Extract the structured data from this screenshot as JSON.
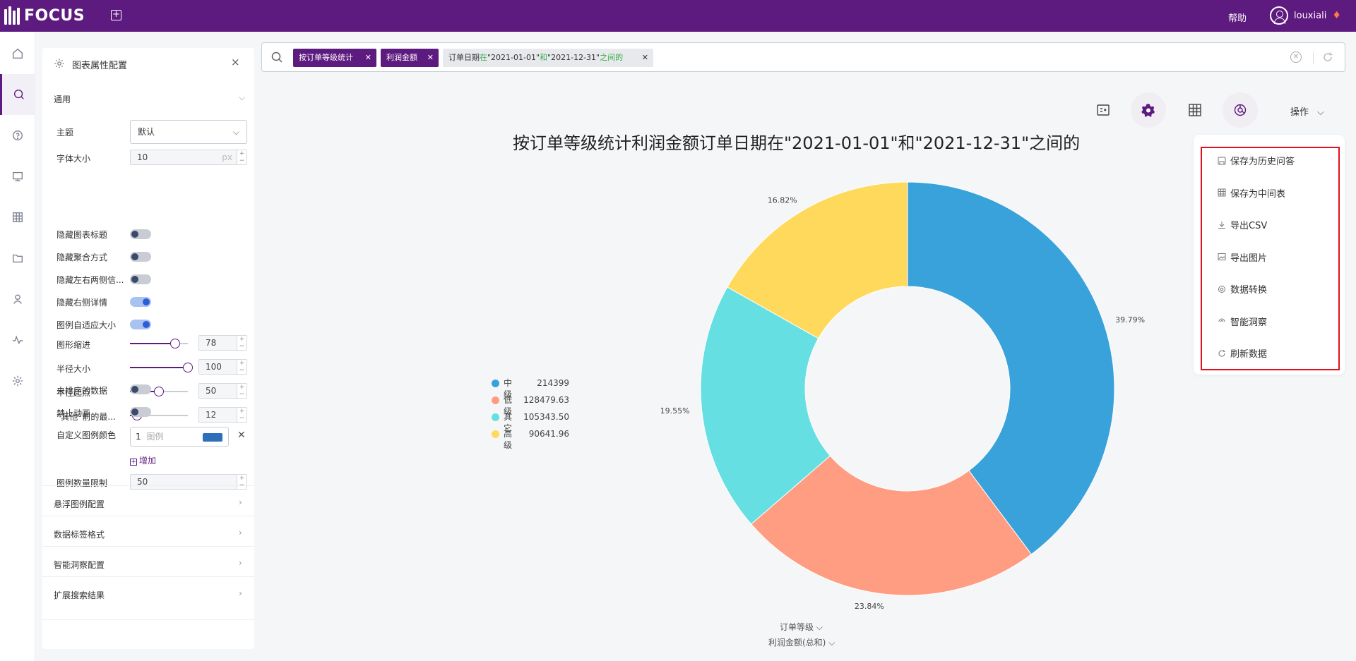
{
  "app": {
    "logo_text": "FOCUS",
    "help_label": "帮助",
    "username": "louxiali"
  },
  "panel": {
    "title": "图表属性配置",
    "general_section": "通用",
    "theme_label": "主题",
    "theme_value": "默认",
    "font_size_label": "字体大小",
    "font_size_value": "10",
    "font_size_unit": "px",
    "toggles": [
      {
        "label": "隐藏图表标题",
        "on": false
      },
      {
        "label": "隐藏聚合方式",
        "on": false
      },
      {
        "label": "隐藏左右两侧信...",
        "on": false
      },
      {
        "label": "隐藏右侧详情",
        "on": true
      },
      {
        "label": "图例自适应大小",
        "on": true
      }
    ],
    "sliders": [
      {
        "label": "图形缩进",
        "value": "78",
        "fraction": 0.78
      },
      {
        "label": "半径大小",
        "value": "100",
        "fraction": 1.0
      },
      {
        "label": "半径起点",
        "value": "50",
        "fraction": 0.5
      },
      {
        "label": "“其他”前的最...",
        "value": "12",
        "fraction": 0.12
      }
    ],
    "unsorted_label": "未排序的数据",
    "disable_anim_label": "禁止动画",
    "custom_color_label": "自定义图例颜色",
    "color_index": "1",
    "color_placeholder": "图例",
    "color_swatch": "#2d6fb8",
    "add_label": "增加",
    "legend_limit_label": "图例数量限制",
    "legend_limit_value": "50",
    "sections": [
      "悬浮图例配置",
      "数据标签格式",
      "智能洞察配置",
      "扩展搜索结果"
    ]
  },
  "search": {
    "tags": [
      {
        "text": "按订单等级统计",
        "style": "purple"
      },
      {
        "text": "利润金额",
        "style": "purple"
      }
    ],
    "filter_tag": {
      "prefix": "订单日期",
      "op1": "在",
      "v1": "\"2021-01-01\"",
      "op2": "和",
      "v2": "\"2021-12-31\"",
      "suffix": "之间的"
    }
  },
  "toolbar": {
    "ops_label": "操作"
  },
  "chart_data": {
    "type": "pie",
    "donut": true,
    "title": "按订单等级统计利润金额订单日期在\"2021-01-01\"和\"2021-12-31\"之间的",
    "slices": [
      {
        "name": "中级",
        "value": 214399,
        "value_label": "214399",
        "percent": "39.79%",
        "color": "#3aa2db"
      },
      {
        "name": "低级",
        "value": 128479.63,
        "value_label": "128479.63",
        "percent": "23.84%",
        "color": "#ff9d82"
      },
      {
        "name": "其它",
        "value": 105343.5,
        "value_label": "105343.50",
        "percent": "19.55%",
        "color": "#66dfe2"
      },
      {
        "name": "高级",
        "value": 90641.96,
        "value_label": "90641.96",
        "percent": "16.82%",
        "color": "#ffd95b"
      }
    ],
    "category_field": "订单等级",
    "value_field": "利润金额(总和)"
  },
  "menu": {
    "items": [
      {
        "label": "保存为历史问答",
        "icon": "save-icon"
      },
      {
        "label": "保存为中间表",
        "icon": "table-icon"
      },
      {
        "label": "导出CSV",
        "icon": "download-icon"
      },
      {
        "label": "导出图片",
        "icon": "image-icon"
      },
      {
        "label": "数据转换",
        "icon": "gear-icon"
      },
      {
        "label": "智能洞察",
        "icon": "insight-icon"
      },
      {
        "label": "刷新数据",
        "icon": "refresh-icon"
      }
    ]
  }
}
